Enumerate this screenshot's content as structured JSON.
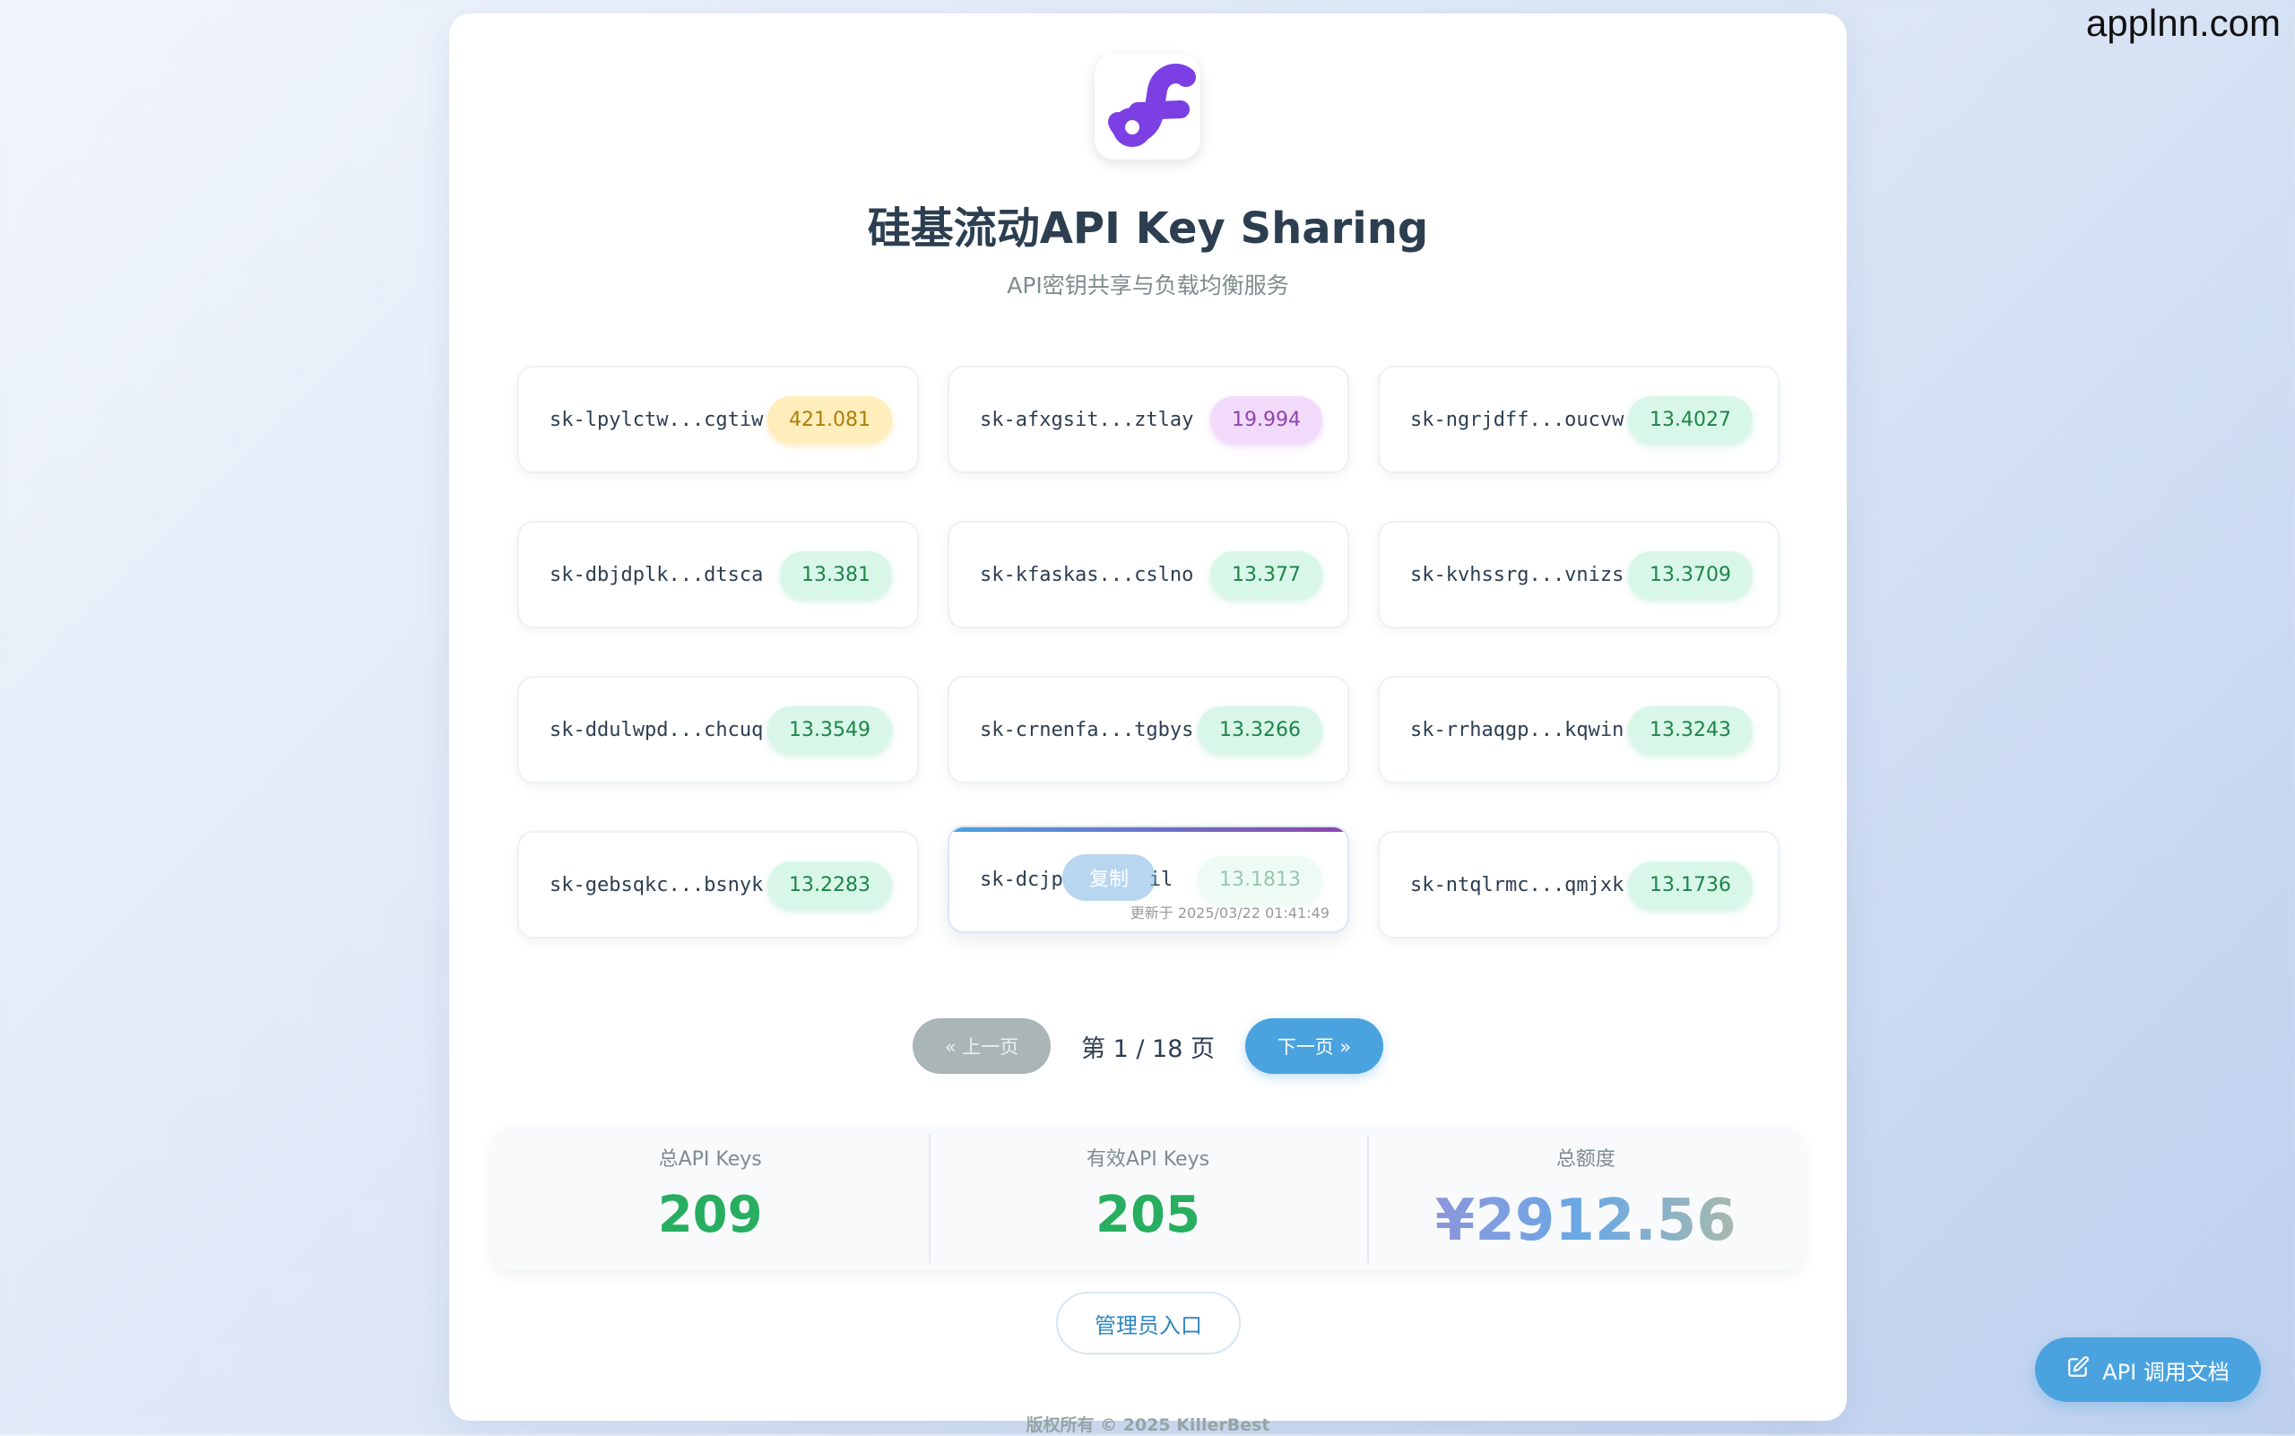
{
  "watermark": "applnn.com",
  "header": {
    "title": "硅基流动API Key Sharing",
    "subtitle": "API密钥共享与负载均衡服务",
    "logo_icon": "siliconflow-logo-icon"
  },
  "keys": [
    {
      "key": "sk-lpylctw...cgtiw",
      "balance": "421.081",
      "tone": "gold"
    },
    {
      "key": "sk-afxgsit...ztlay",
      "balance": "19.994",
      "tone": "purple"
    },
    {
      "key": "sk-ngrjdff...oucvw",
      "balance": "13.4027",
      "tone": "green"
    },
    {
      "key": "sk-dbjdplk...dtsca",
      "balance": "13.381",
      "tone": "green"
    },
    {
      "key": "sk-kfaskas...cslno",
      "balance": "13.377",
      "tone": "green"
    },
    {
      "key": "sk-kvhssrg...vnizs",
      "balance": "13.3709",
      "tone": "green"
    },
    {
      "key": "sk-ddulwpd...chcuq",
      "balance": "13.3549",
      "tone": "green"
    },
    {
      "key": "sk-crnenfa...tgbys",
      "balance": "13.3266",
      "tone": "green"
    },
    {
      "key": "sk-rrhaqgp...kqwin",
      "balance": "13.3243",
      "tone": "green"
    },
    {
      "key": "sk-gebsqkc...bsnyk",
      "balance": "13.2283",
      "tone": "green"
    },
    {
      "key": "sk-dcjp",
      "key_tail": "il",
      "balance": "13.1813",
      "tone": "green",
      "hovered": true,
      "copy_label": "复制",
      "updated": "更新于 2025/03/22 01:41:49"
    },
    {
      "key": "sk-ntqlrmc...qmjxk",
      "balance": "13.1736",
      "tone": "green"
    }
  ],
  "pagination": {
    "prev_label": "« 上一页",
    "page_info": "第 1 / 18 页",
    "next_label": "下一页 »"
  },
  "stats": {
    "total_label": "总API Keys",
    "total_value": "209",
    "valid_label": "有效API Keys",
    "valid_value": "205",
    "balance_label": "总额度",
    "balance_value": "¥2912.56"
  },
  "admin_label": "管理员入口",
  "footer": "版权所有 © 2025 KillerBest",
  "docs_button": {
    "label": "API 调用文档",
    "icon": "edit-icon"
  },
  "colors": {
    "accent": "#4aa3df",
    "brand": "#7b3fe4",
    "green": "#27ae60"
  }
}
